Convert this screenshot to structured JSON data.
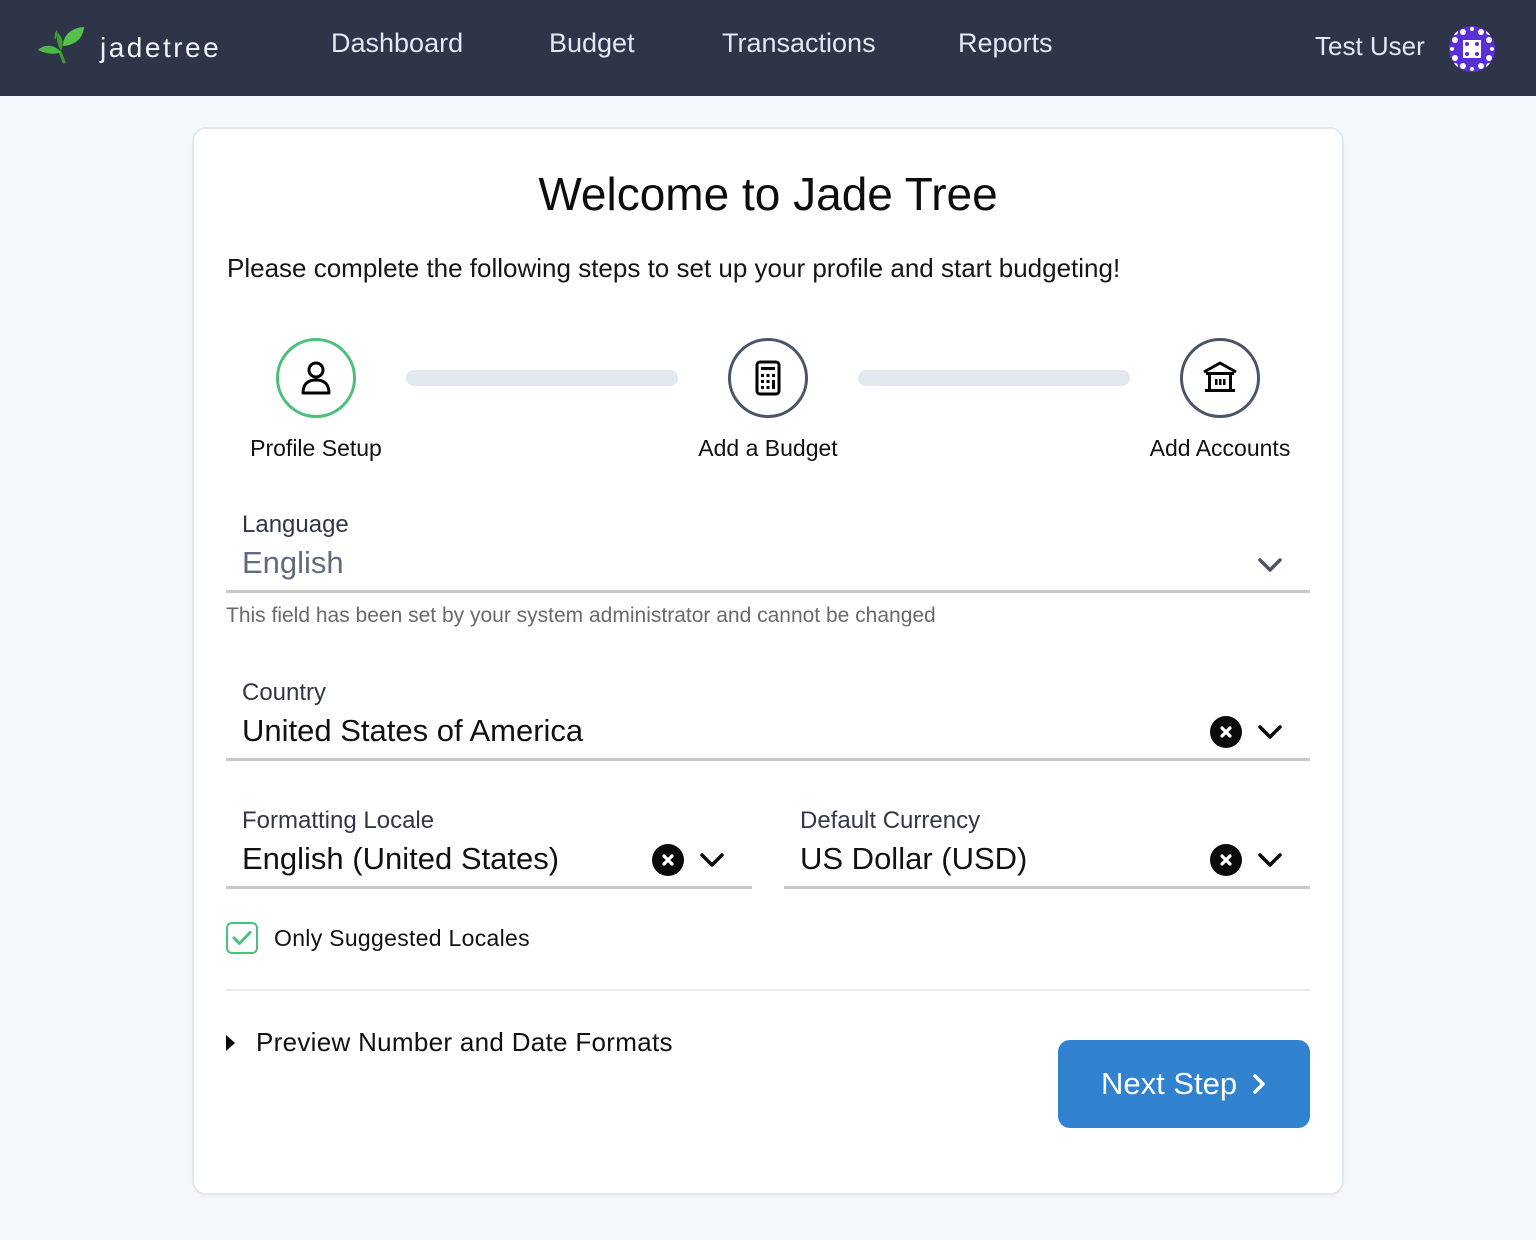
{
  "navbar": {
    "brand": "jadetree",
    "links": [
      {
        "label": "Dashboard"
      },
      {
        "label": "Budget"
      },
      {
        "label": "Transactions"
      },
      {
        "label": "Reports"
      }
    ],
    "user_name": "Test User",
    "background": "#2e3548"
  },
  "card": {
    "title": "Welcome to Jade Tree",
    "subtitle": "Please complete the following steps to set up your profile and start budgeting!"
  },
  "stepper": {
    "steps": [
      {
        "label": "Profile Setup",
        "icon": "user-icon",
        "active": true
      },
      {
        "label": "Add a Budget",
        "icon": "calculator-icon",
        "active": false
      },
      {
        "label": "Add Accounts",
        "icon": "bank-icon",
        "active": false
      }
    ],
    "active_color": "#4cbf7c",
    "inactive_color": "#4b5568"
  },
  "form": {
    "language": {
      "label": "Language",
      "value": "English",
      "disabled": true,
      "hint": "This field has been set by your system administrator and cannot be changed"
    },
    "country": {
      "label": "Country",
      "value": "United States of America"
    },
    "locale": {
      "label": "Formatting Locale",
      "value": "English (United States)"
    },
    "currency": {
      "label": "Default Currency",
      "value": "US Dollar (USD)"
    },
    "only_suggested": {
      "label": "Only Suggested Locales",
      "checked": true
    },
    "preview_toggle": "Preview Number and Date Formats",
    "next_button": "Next Step"
  },
  "colors": {
    "primary_button": "#3182ce",
    "success": "#4cbf7c"
  }
}
